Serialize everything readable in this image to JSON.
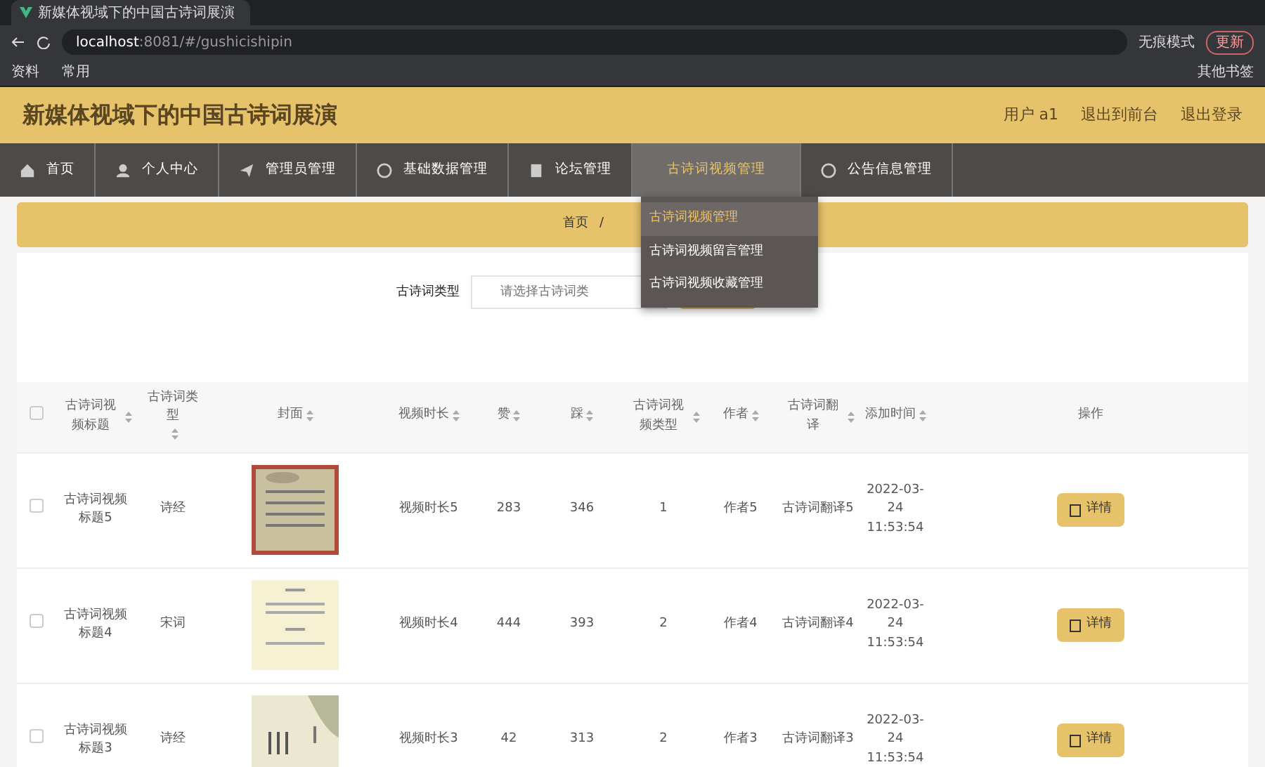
{
  "browser": {
    "tab_title": "新媒体视域下的中国古诗词展演",
    "url_host": "localhost",
    "url_rest": ":8081/#/gushicishipin",
    "profile": "无痕模式",
    "update": "更新",
    "bookmarks": [
      "资料",
      "常用"
    ],
    "other_bookmarks": "其他书签"
  },
  "header": {
    "title": "新媒体视域下的中国古诗词展演",
    "links": [
      "用户 a1",
      "退出到前台",
      "退出登录"
    ]
  },
  "nav": [
    {
      "label": "首页",
      "selected": false
    },
    {
      "label": "个人中心",
      "selected": false
    },
    {
      "label": "管理员管理",
      "selected": false
    },
    {
      "label": "基础数据管理",
      "selected": false
    },
    {
      "label": "论坛管理",
      "selected": false
    },
    {
      "label": "古诗词视频管理",
      "selected": true
    },
    {
      "label": "公告信息管理",
      "selected": false
    }
  ],
  "dropdown": [
    {
      "label": "古诗词视频管理",
      "selected": true
    },
    {
      "label": "古诗词视频留言管理",
      "selected": false
    },
    {
      "label": "古诗词视频收藏管理",
      "selected": false
    }
  ],
  "breadcrumb": [
    "首页",
    "/"
  ],
  "search": {
    "label": "古诗词类型",
    "placeholder": "请选择古诗词类"
  },
  "table": {
    "select_all_checked": false,
    "columns": [
      "古诗词视频标题",
      "古诗词类型",
      "封面",
      "视频时长",
      "赞",
      "踩",
      "古诗词视频类型",
      "作者",
      "古诗词翻译",
      "添加时间",
      "操作"
    ],
    "rows": [
      {
        "checked": false,
        "title": "古诗词视频标题5",
        "type": "诗经",
        "duration": "视频时长5",
        "likes": "283",
        "dislikes": "346",
        "video_type": "1",
        "author": "作者5",
        "translation": "古诗词翻译5",
        "time": "2022-03-24 11:53:54",
        "action": "详情"
      },
      {
        "checked": false,
        "title": "古诗词视频标题4",
        "type": "宋词",
        "duration": "视频时长4",
        "likes": "444",
        "dislikes": "393",
        "video_type": "2",
        "author": "作者4",
        "translation": "古诗词翻译4",
        "time": "2022-03-24 11:53:54",
        "action": "详情"
      },
      {
        "checked": false,
        "title": "古诗词视频标题3",
        "type": "诗经",
        "duration": "视频时长3",
        "likes": "42",
        "dislikes": "313",
        "video_type": "2",
        "author": "作者3",
        "translation": "古诗词翻译3",
        "time": "2022-03-24 11:53:54",
        "action": "详情"
      }
    ]
  }
}
